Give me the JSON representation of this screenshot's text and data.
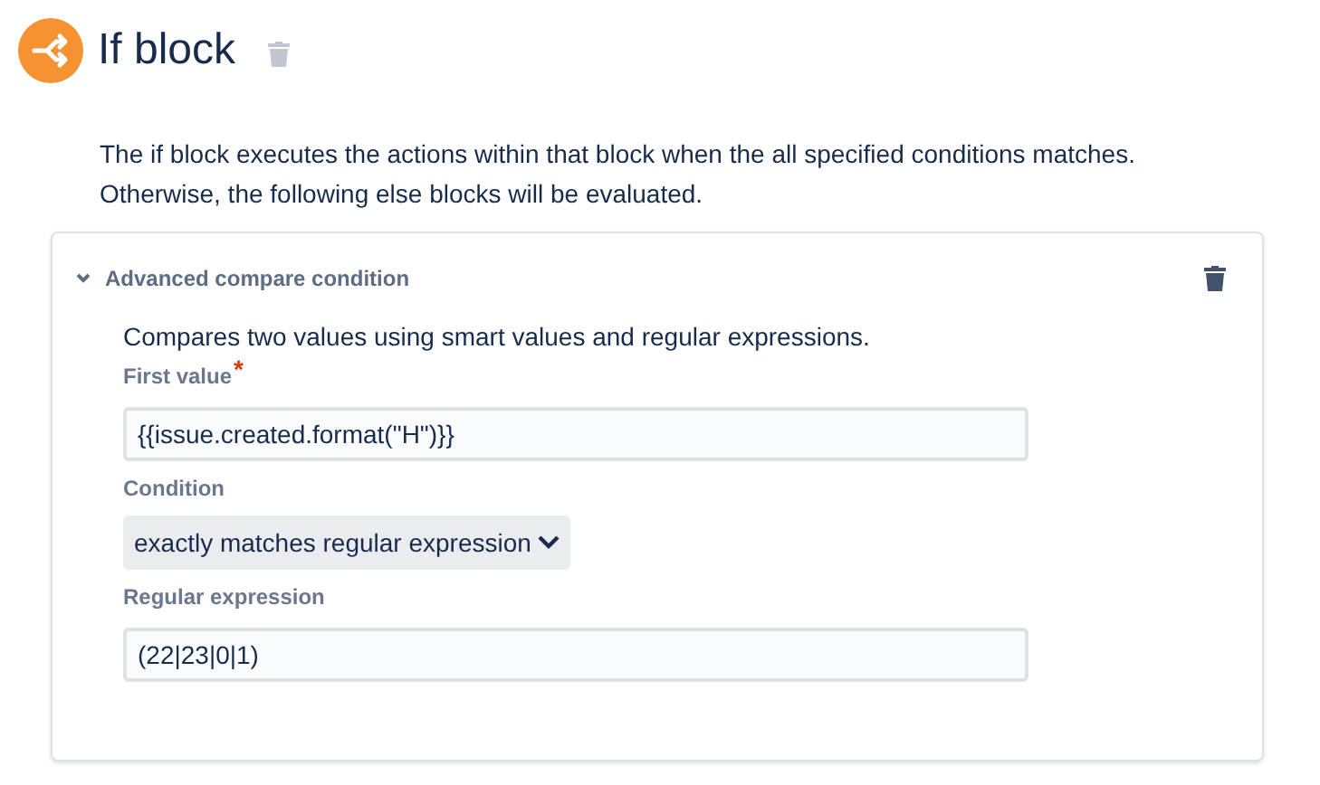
{
  "header": {
    "title": "If block"
  },
  "description": "The if block executes the actions within that block when the all specified conditions matches. Otherwise, the following else blocks will be evaluated.",
  "condition_card": {
    "title": "Advanced compare condition",
    "expanded": true,
    "description": "Compares two values using smart values and regular expressions.",
    "fields": [
      {
        "kind": "input",
        "label": "First value",
        "required_mark": "*",
        "value": "{{issue.created.format(\"H\")}}"
      },
      {
        "kind": "select",
        "label": "Condition",
        "value": "exactly matches regular expression"
      },
      {
        "kind": "input",
        "label": "Regular expression",
        "value": "(22|23|0|1)"
      }
    ]
  }
}
